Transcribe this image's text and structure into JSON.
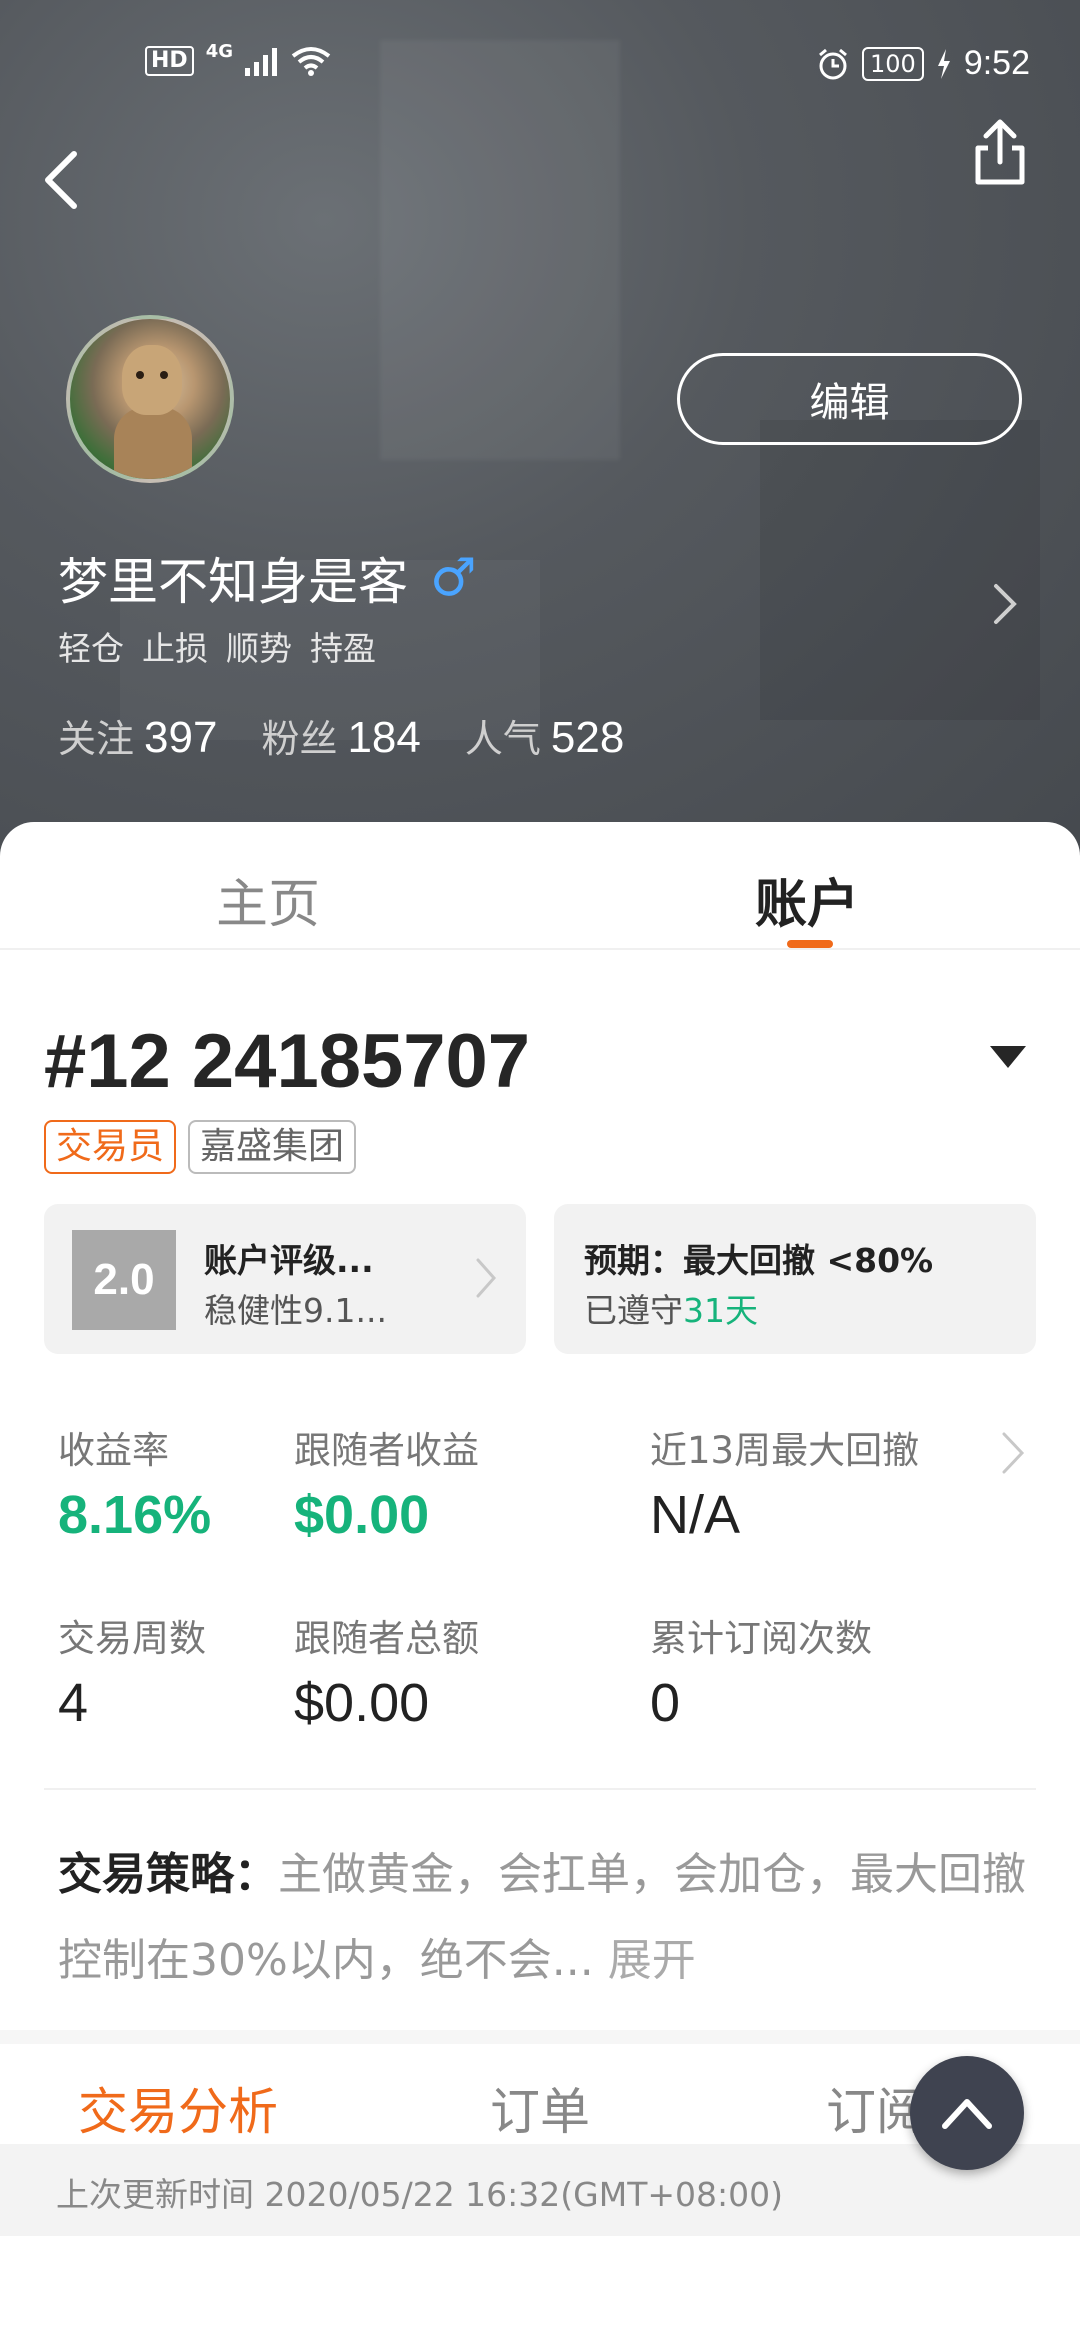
{
  "status_bar": {
    "hd": "HD",
    "network": "4G",
    "battery": "100",
    "time": "9:52"
  },
  "profile": {
    "edit_label": "编辑",
    "username": "梦里不知身是客",
    "gender_symbol": "♂",
    "tags": [
      "轻仓",
      "止损",
      "顺势",
      "持盈"
    ],
    "stats": [
      {
        "label": "关注",
        "value": "397"
      },
      {
        "label": "粉丝",
        "value": "184"
      },
      {
        "label": "人气",
        "value": "528"
      }
    ]
  },
  "tabs": {
    "home": "主页",
    "account": "账户"
  },
  "account": {
    "number": "#12 24185707",
    "badge_role": "交易员",
    "badge_company": "嘉盛集团",
    "rating_score": "2.0",
    "rating_title": "账户评级...",
    "rating_sub": "稳健性9.1...",
    "expect_title": "预期：最大回撤 <80%",
    "expect_sub_prefix": "已遵守",
    "expect_sub_days": "31天"
  },
  "metrics": [
    {
      "label": "收益率",
      "value": "8.16%"
    },
    {
      "label": "跟随者收益",
      "value": "$0.00"
    },
    {
      "label": "近13周最大回撤",
      "value": "N/A"
    },
    {
      "label": "交易周数",
      "value": "4"
    },
    {
      "label": "跟随者总额",
      "value": "$0.00"
    },
    {
      "label": "累计订阅次数",
      "value": "0"
    }
  ],
  "strategy": {
    "label": "交易策略：",
    "text": "主做黄金，会扛单，会加仓，最大回撤控制在30%以内，绝不会...",
    "expand": "展开"
  },
  "sub_tabs": {
    "analysis": "交易分析",
    "orders": "订单",
    "subscribers": "订阅者"
  },
  "update": {
    "text": "上次更新时间 2020/05/22 16:32(GMT+08:00)"
  },
  "colors": {
    "accent": "#f06a1a",
    "positive": "#16b37b",
    "gender": "#4aa4ff"
  },
  "icons": [
    "back-arrow-icon",
    "share-icon",
    "chevron-right-icon",
    "dropdown-triangle-icon",
    "male-gender-icon",
    "arrow-up-icon"
  ]
}
